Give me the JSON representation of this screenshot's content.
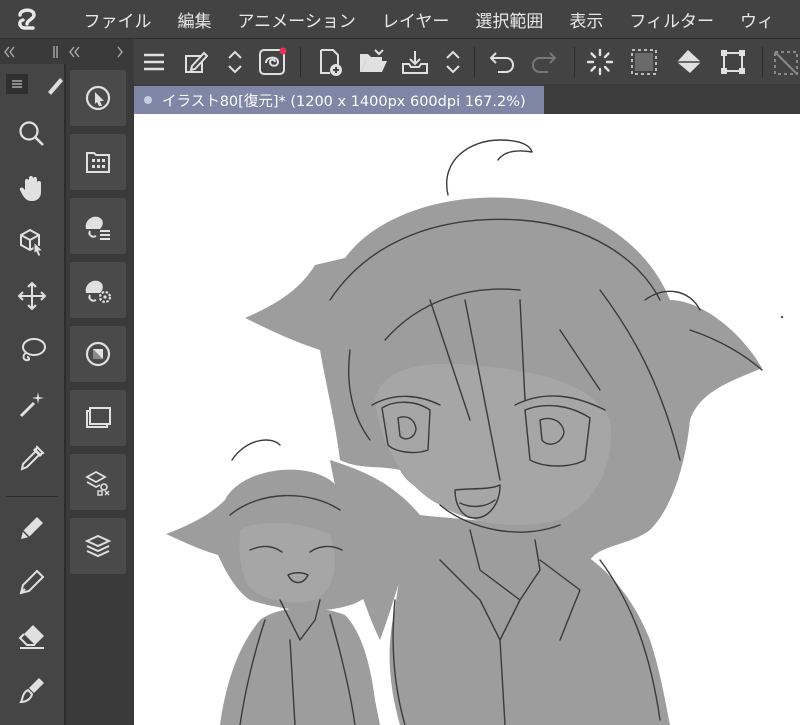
{
  "app": {
    "logo_icon": "clip-studio-logo-icon"
  },
  "menu": [
    "ファイル",
    "編集",
    "アニメーション",
    "レイヤー",
    "選択範囲",
    "表示",
    "フィルター",
    "ウィ"
  ],
  "document": {
    "tab_title": "イラスト80[復元]* (1200 x 1400px 600dpi 167.2%)"
  },
  "toolbar_icons": [
    "menu-icon",
    "edit-layer-icon",
    "up-down-icon",
    "cloud-sync-icon",
    "new-canvas-icon",
    "open-folder-icon",
    "save-icon",
    "up-down-icon",
    "undo-icon",
    "redo-icon",
    "loading-icon",
    "clear-selection-icon",
    "fill-icon",
    "transform-icon",
    "selection-launcher-icon"
  ],
  "tools": [
    "zoom-icon",
    "hand-icon",
    "operation-icon",
    "move-icon",
    "lasso-icon",
    "magic-wand-icon",
    "eyedropper-icon",
    "pen-icon",
    "pencil-icon",
    "eraser-icon",
    "brush-icon"
  ],
  "subpanels": [
    "navigator-icon",
    "material-icon",
    "tool-property-icon",
    "sub-tool-detail-icon",
    "color-icon",
    "layer-property-icon",
    "layer-search-icon",
    "layers-icon"
  ],
  "colors": {
    "canvas_bg": "#ffffff",
    "fill_gray": "#9d9d9d",
    "line": "#3a3a3a",
    "tab": "#7f86a6",
    "ui_dark": "#3b3b3b"
  }
}
